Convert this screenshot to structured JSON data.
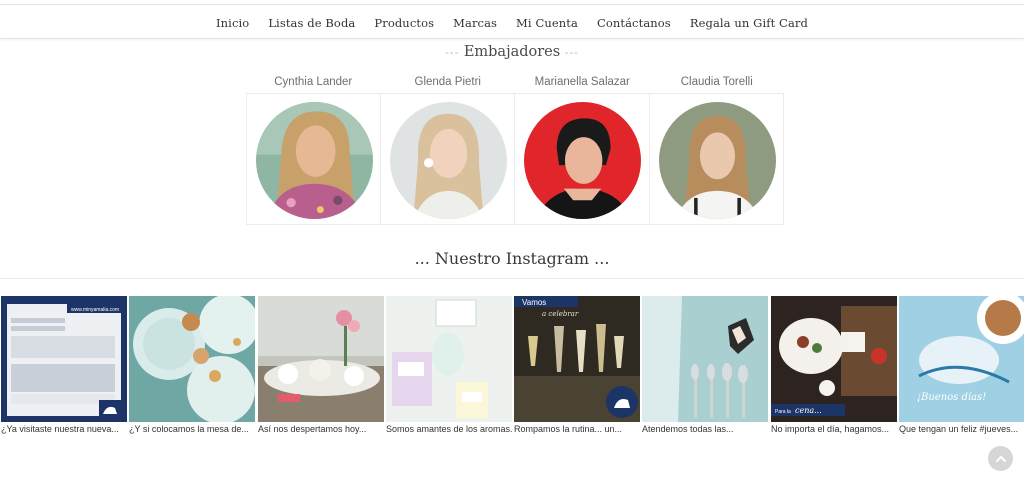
{
  "nav": {
    "items": [
      "Inicio",
      "Listas de Boda",
      "Productos",
      "Marcas",
      "Mi Cuenta",
      "Contáctanos",
      "Regala un Gift Card"
    ]
  },
  "ambassadors": {
    "title": "Embajadores",
    "people": [
      {
        "name": "Cynthia Lander"
      },
      {
        "name": "Glenda Pietri"
      },
      {
        "name": "Marianella Salazar"
      },
      {
        "name": "Claudia Torelli"
      }
    ]
  },
  "instagram": {
    "title": "... Nuestro Instagram ...",
    "posts": [
      {
        "caption": "¿Ya visitaste nuestra nueva..."
      },
      {
        "caption": "¿Y si colocamos la mesa de..."
      },
      {
        "caption": "Así nos despertamos hoy..."
      },
      {
        "caption": "Somos amantes de los aromas..."
      },
      {
        "caption": "Rompamos la rutina... un..."
      },
      {
        "caption": "Atendemos todas las..."
      },
      {
        "caption": "No importa el día, hagamos..."
      },
      {
        "caption": "Que tengan un feliz #jueves..."
      }
    ],
    "image_text": {
      "url": "www.minyamalia.com",
      "vamos": "Vamos",
      "celebrar": "a celebrar",
      "cena_prefix": "Para la",
      "cena": "cena...",
      "buenos": "¡Buenos días!"
    }
  },
  "colors": {
    "navy": "#1d3466",
    "accent_red": "#e03232"
  }
}
